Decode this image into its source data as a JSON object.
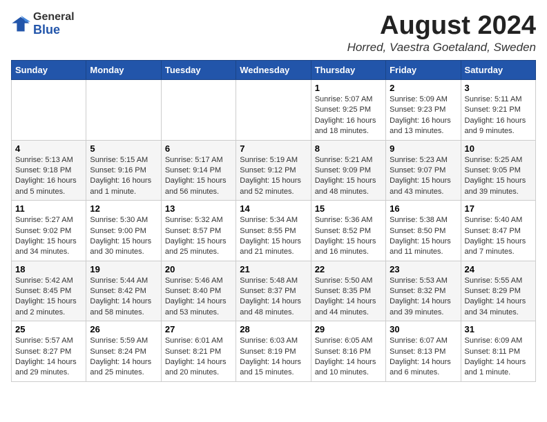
{
  "header": {
    "logo_general": "General",
    "logo_blue": "Blue",
    "title": "August 2024",
    "subtitle": "Horred, Vaestra Goetaland, Sweden"
  },
  "weekdays": [
    "Sunday",
    "Monday",
    "Tuesday",
    "Wednesday",
    "Thursday",
    "Friday",
    "Saturday"
  ],
  "weeks": [
    [
      {
        "day": "",
        "info": ""
      },
      {
        "day": "",
        "info": ""
      },
      {
        "day": "",
        "info": ""
      },
      {
        "day": "",
        "info": ""
      },
      {
        "day": "1",
        "info": "Sunrise: 5:07 AM\nSunset: 9:25 PM\nDaylight: 16 hours\nand 18 minutes."
      },
      {
        "day": "2",
        "info": "Sunrise: 5:09 AM\nSunset: 9:23 PM\nDaylight: 16 hours\nand 13 minutes."
      },
      {
        "day": "3",
        "info": "Sunrise: 5:11 AM\nSunset: 9:21 PM\nDaylight: 16 hours\nand 9 minutes."
      }
    ],
    [
      {
        "day": "4",
        "info": "Sunrise: 5:13 AM\nSunset: 9:18 PM\nDaylight: 16 hours\nand 5 minutes."
      },
      {
        "day": "5",
        "info": "Sunrise: 5:15 AM\nSunset: 9:16 PM\nDaylight: 16 hours\nand 1 minute."
      },
      {
        "day": "6",
        "info": "Sunrise: 5:17 AM\nSunset: 9:14 PM\nDaylight: 15 hours\nand 56 minutes."
      },
      {
        "day": "7",
        "info": "Sunrise: 5:19 AM\nSunset: 9:12 PM\nDaylight: 15 hours\nand 52 minutes."
      },
      {
        "day": "8",
        "info": "Sunrise: 5:21 AM\nSunset: 9:09 PM\nDaylight: 15 hours\nand 48 minutes."
      },
      {
        "day": "9",
        "info": "Sunrise: 5:23 AM\nSunset: 9:07 PM\nDaylight: 15 hours\nand 43 minutes."
      },
      {
        "day": "10",
        "info": "Sunrise: 5:25 AM\nSunset: 9:05 PM\nDaylight: 15 hours\nand 39 minutes."
      }
    ],
    [
      {
        "day": "11",
        "info": "Sunrise: 5:27 AM\nSunset: 9:02 PM\nDaylight: 15 hours\nand 34 minutes."
      },
      {
        "day": "12",
        "info": "Sunrise: 5:30 AM\nSunset: 9:00 PM\nDaylight: 15 hours\nand 30 minutes."
      },
      {
        "day": "13",
        "info": "Sunrise: 5:32 AM\nSunset: 8:57 PM\nDaylight: 15 hours\nand 25 minutes."
      },
      {
        "day": "14",
        "info": "Sunrise: 5:34 AM\nSunset: 8:55 PM\nDaylight: 15 hours\nand 21 minutes."
      },
      {
        "day": "15",
        "info": "Sunrise: 5:36 AM\nSunset: 8:52 PM\nDaylight: 15 hours\nand 16 minutes."
      },
      {
        "day": "16",
        "info": "Sunrise: 5:38 AM\nSunset: 8:50 PM\nDaylight: 15 hours\nand 11 minutes."
      },
      {
        "day": "17",
        "info": "Sunrise: 5:40 AM\nSunset: 8:47 PM\nDaylight: 15 hours\nand 7 minutes."
      }
    ],
    [
      {
        "day": "18",
        "info": "Sunrise: 5:42 AM\nSunset: 8:45 PM\nDaylight: 15 hours\nand 2 minutes."
      },
      {
        "day": "19",
        "info": "Sunrise: 5:44 AM\nSunset: 8:42 PM\nDaylight: 14 hours\nand 58 minutes."
      },
      {
        "day": "20",
        "info": "Sunrise: 5:46 AM\nSunset: 8:40 PM\nDaylight: 14 hours\nand 53 minutes."
      },
      {
        "day": "21",
        "info": "Sunrise: 5:48 AM\nSunset: 8:37 PM\nDaylight: 14 hours\nand 48 minutes."
      },
      {
        "day": "22",
        "info": "Sunrise: 5:50 AM\nSunset: 8:35 PM\nDaylight: 14 hours\nand 44 minutes."
      },
      {
        "day": "23",
        "info": "Sunrise: 5:53 AM\nSunset: 8:32 PM\nDaylight: 14 hours\nand 39 minutes."
      },
      {
        "day": "24",
        "info": "Sunrise: 5:55 AM\nSunset: 8:29 PM\nDaylight: 14 hours\nand 34 minutes."
      }
    ],
    [
      {
        "day": "25",
        "info": "Sunrise: 5:57 AM\nSunset: 8:27 PM\nDaylight: 14 hours\nand 29 minutes."
      },
      {
        "day": "26",
        "info": "Sunrise: 5:59 AM\nSunset: 8:24 PM\nDaylight: 14 hours\nand 25 minutes."
      },
      {
        "day": "27",
        "info": "Sunrise: 6:01 AM\nSunset: 8:21 PM\nDaylight: 14 hours\nand 20 minutes."
      },
      {
        "day": "28",
        "info": "Sunrise: 6:03 AM\nSunset: 8:19 PM\nDaylight: 14 hours\nand 15 minutes."
      },
      {
        "day": "29",
        "info": "Sunrise: 6:05 AM\nSunset: 8:16 PM\nDaylight: 14 hours\nand 10 minutes."
      },
      {
        "day": "30",
        "info": "Sunrise: 6:07 AM\nSunset: 8:13 PM\nDaylight: 14 hours\nand 6 minutes."
      },
      {
        "day": "31",
        "info": "Sunrise: 6:09 AM\nSunset: 8:11 PM\nDaylight: 14 hours\nand 1 minute."
      }
    ]
  ]
}
